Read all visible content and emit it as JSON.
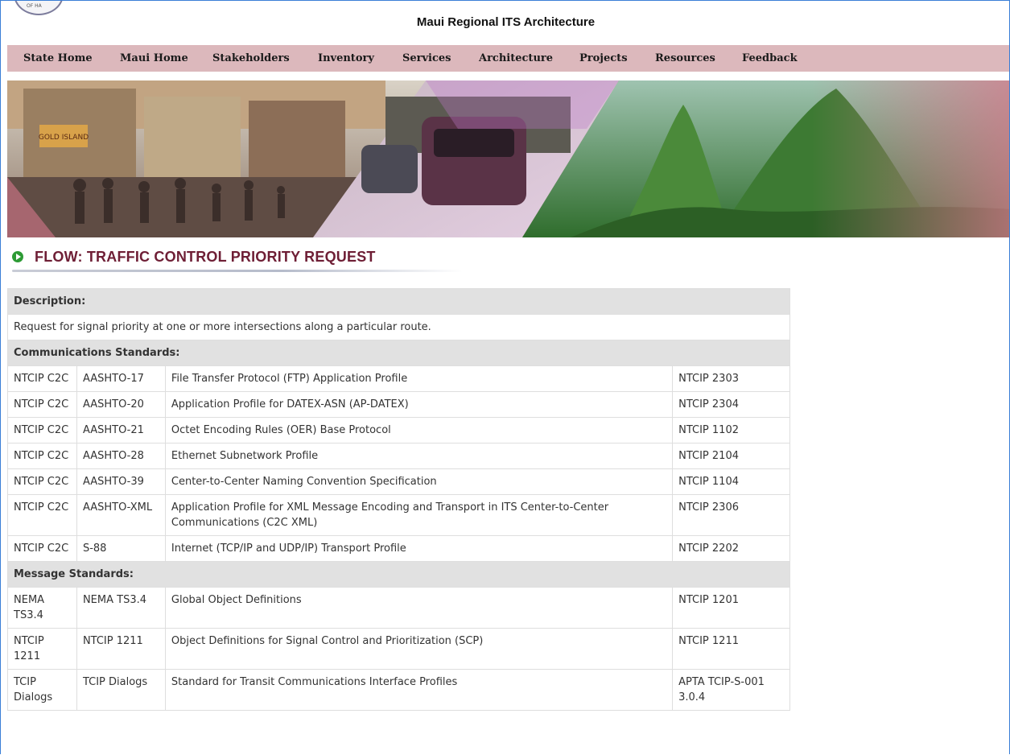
{
  "header": {
    "title": "Maui Regional ITS Architecture",
    "seal_text": "OF HA"
  },
  "nav": {
    "items": [
      {
        "label": "State Home"
      },
      {
        "label": "Maui Home"
      },
      {
        "label": "Stakeholders"
      },
      {
        "label": "Inventory"
      },
      {
        "label": "Services"
      },
      {
        "label": "Architecture"
      },
      {
        "label": "Projects"
      },
      {
        "label": "Resources"
      },
      {
        "label": "Feedback"
      }
    ]
  },
  "banner": {
    "sign_text": "GOLD ISLAND"
  },
  "flow": {
    "title": "FLOW: TRAFFIC CONTROL PRIORITY REQUEST",
    "description_label": "Description:",
    "description": "Request for signal priority at one or more intersections along a particular route.",
    "comm_label": "Communications Standards:",
    "comm_rows": [
      [
        "NTCIP C2C",
        "AASHTO-17",
        "File Transfer Protocol (FTP) Application Profile",
        "NTCIP 2303"
      ],
      [
        "NTCIP C2C",
        "AASHTO-20",
        "Application Profile for DATEX-ASN (AP-DATEX)",
        "NTCIP 2304"
      ],
      [
        "NTCIP C2C",
        "AASHTO-21",
        "Octet Encoding Rules (OER) Base Protocol",
        "NTCIP 1102"
      ],
      [
        "NTCIP C2C",
        "AASHTO-28",
        "Ethernet Subnetwork Profile",
        "NTCIP 2104"
      ],
      [
        "NTCIP C2C",
        "AASHTO-39",
        "Center-to-Center Naming Convention Specification",
        "NTCIP 1104"
      ],
      [
        "NTCIP C2C",
        "AASHTO-XML",
        "Application Profile for XML Message Encoding and Transport in ITS Center-to-Center Communications (C2C XML)",
        "NTCIP 2306"
      ],
      [
        "NTCIP C2C",
        "S-88",
        "Internet (TCP/IP and UDP/IP) Transport Profile",
        "NTCIP 2202"
      ]
    ],
    "msg_label": "Message Standards:",
    "msg_rows": [
      [
        "NEMA TS3.4",
        "NEMA TS3.4",
        "Global Object Definitions",
        "NTCIP 1201"
      ],
      [
        "NTCIP 1211",
        "NTCIP 1211",
        "Object Definitions for Signal Control and Prioritization (SCP)",
        "NTCIP 1211"
      ],
      [
        "TCIP Dialogs",
        "TCIP Dialogs",
        "Standard for Transit Communications Interface Profiles",
        "APTA TCIP-S-001 3.0.4"
      ]
    ]
  }
}
